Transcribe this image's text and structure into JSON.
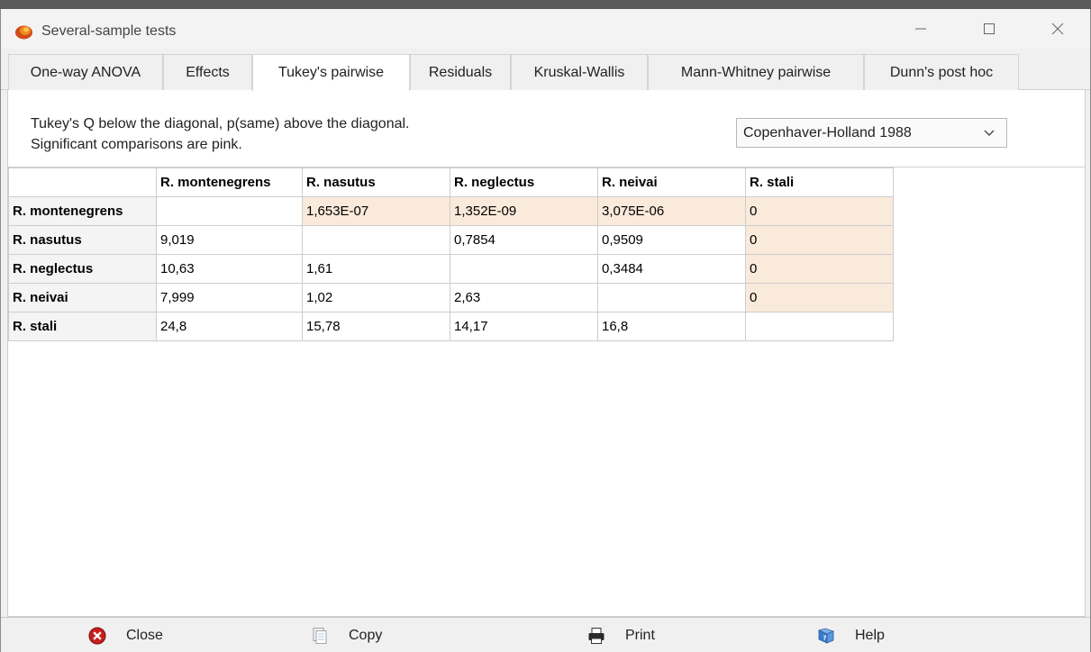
{
  "window": {
    "title": "Several-sample tests"
  },
  "tabs": [
    {
      "label": "One-way ANOVA",
      "active": false
    },
    {
      "label": "Effects",
      "active": false
    },
    {
      "label": "Tukey's pairwise",
      "active": true
    },
    {
      "label": "Residuals",
      "active": false
    },
    {
      "label": "Kruskal-Wallis",
      "active": false
    },
    {
      "label": "Mann-Whitney pairwise",
      "active": false
    },
    {
      "label": "Dunn's post hoc",
      "active": false
    }
  ],
  "description": {
    "line1": "Tukey's Q below the diagonal, p(same) above the diagonal.",
    "line2": "Significant comparisons are pink."
  },
  "method_select": {
    "value": "Copenhaver-Holland 1988"
  },
  "matrix": {
    "columns": [
      "R. montenegrens",
      "R. nasutus",
      "R. neglectus",
      "R. neivai",
      "R. stali"
    ],
    "rows": [
      {
        "label": "R. montenegrens",
        "cells": [
          "",
          "1,653E-07",
          "1,352E-09",
          "3,075E-06",
          "0"
        ],
        "pink": [
          false,
          true,
          true,
          true,
          true
        ]
      },
      {
        "label": "R. nasutus",
        "cells": [
          "9,019",
          "",
          "0,7854",
          "0,9509",
          "0"
        ],
        "pink": [
          false,
          false,
          false,
          false,
          true
        ]
      },
      {
        "label": "R. neglectus",
        "cells": [
          "10,63",
          "1,61",
          "",
          "0,3484",
          "0"
        ],
        "pink": [
          false,
          false,
          false,
          false,
          true
        ]
      },
      {
        "label": "R. neivai",
        "cells": [
          "7,999",
          "1,02",
          "2,63",
          "",
          "0"
        ],
        "pink": [
          false,
          false,
          false,
          false,
          true
        ]
      },
      {
        "label": "R. stali",
        "cells": [
          "24,8",
          "15,78",
          "14,17",
          "16,8",
          ""
        ],
        "pink": [
          false,
          false,
          false,
          false,
          false
        ]
      }
    ],
    "pink_color": "#faeadb"
  },
  "bottom_buttons": {
    "close": {
      "label": "Close",
      "icon": "close-icon"
    },
    "copy": {
      "label": "Copy",
      "icon": "copy-icon"
    },
    "print": {
      "label": "Print",
      "icon": "printer-icon"
    },
    "help": {
      "label": "Help",
      "icon": "help-book-icon"
    }
  }
}
